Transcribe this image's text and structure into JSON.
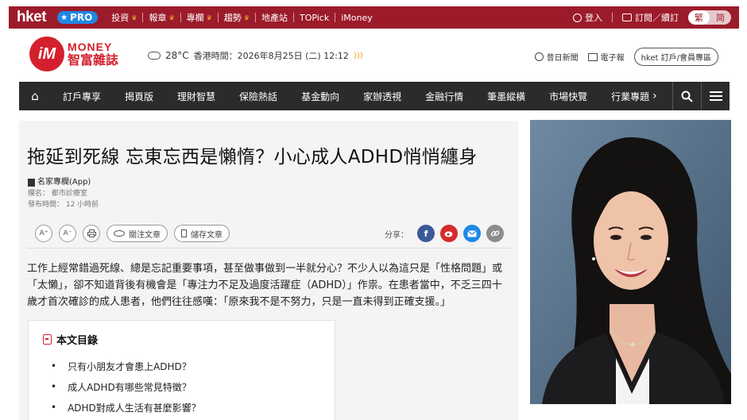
{
  "topbar": {
    "logo": "hket",
    "pro_label": "PRO",
    "nav": [
      "投資",
      "報章",
      "專欄",
      "趨勢",
      "地產站",
      "TOPick",
      "iMoney"
    ],
    "login": "登入",
    "subscribe": "訂閱／續訂",
    "lang_trad": "繁",
    "lang_simp": "简"
  },
  "brand": {
    "logo_en": "MONEY",
    "logo_zh": "智富雜誌",
    "temperature": "28°C",
    "time_text": "香港時間：2026年8月25日 (二) 12:12",
    "history": "昔日新聞",
    "epaper": "電子報",
    "subscribe_btn": "hket 訂戶/會員專區"
  },
  "mainnav": {
    "items": [
      "訂戶專享",
      "揭頁版",
      "理財智慧",
      "保險熱話",
      "基金動向",
      "家辦透視",
      "金融行情",
      "筆墨縱橫",
      "市場快覽",
      "行業專題"
    ]
  },
  "article": {
    "headline": "拖延到死線 忘東忘西是懶惰？小心成人ADHD悄悄纏身",
    "column_type": "名家專欄(App)",
    "column_name": "欄名： 都市診療室",
    "published": "發布時間： 12 小時前",
    "tools": {
      "font_up": "A⁺",
      "font_down": "A⁻",
      "follow": "關注文章",
      "save": "儲存文章",
      "share_label": "分享："
    },
    "body": "工作上經常錯過死線、總是忘記重要事項，甚至做事做到一半就分心？不少人以為這只是「性格問題」或「太懶」，卻不知道背後有機會是「專注力不足及過度活躍症（ADHD）」作祟。在患者當中，不乏三四十歲才首次確診的成人患者，他們往往感嘆：「原來我不是不努力，只是一直未得到正確支援。」",
    "toc": {
      "title": "本文目錄",
      "items": [
        "只有小朋友才會患上ADHD？",
        "成人ADHD有哪些常見特徵？",
        "ADHD對成人生活有甚麼影響？"
      ]
    }
  }
}
